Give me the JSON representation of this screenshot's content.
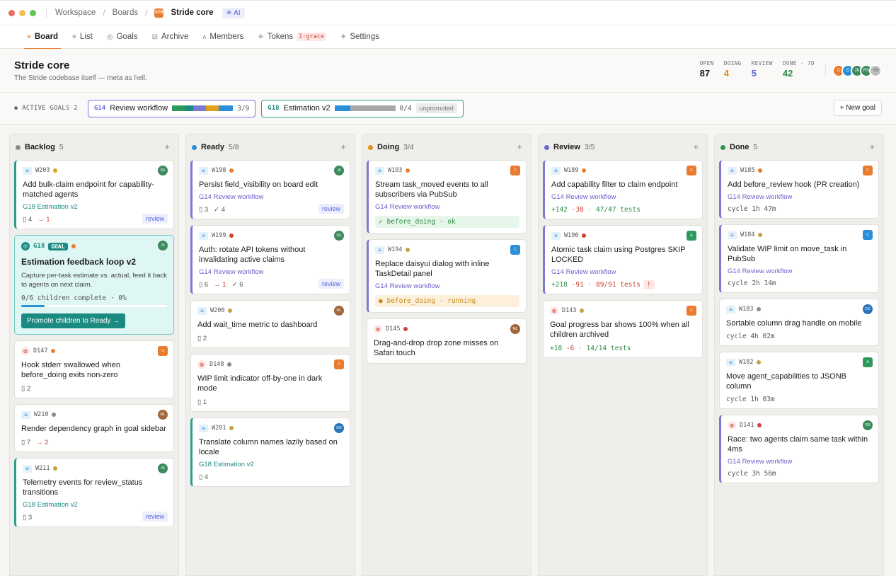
{
  "window": {
    "traffic": [
      "#ee6a5f",
      "#f5be4f",
      "#61c454"
    ]
  },
  "breadcrumb": {
    "workspace": "Workspace",
    "boards": "Boards",
    "badge": "STR",
    "project": "Stride core",
    "ai": "AI"
  },
  "tabs": [
    {
      "label": "Board",
      "icon": "≡",
      "active": true
    },
    {
      "label": "List",
      "icon": "≡"
    },
    {
      "label": "Goals",
      "icon": "◎"
    },
    {
      "label": "Archive",
      "icon": "⊟"
    },
    {
      "label": "Members",
      "icon": "ᴧ"
    },
    {
      "label": "Tokens",
      "icon": "✳",
      "badge": "1·grace"
    },
    {
      "label": "Settings",
      "icon": "✳"
    }
  ],
  "header": {
    "title": "Stride core",
    "desc": "The Stride codebase itself — meta as hell.",
    "stats": [
      {
        "label": "OPEN",
        "value": "87",
        "color": "#1c1c1c"
      },
      {
        "label": "DOING",
        "value": "4",
        "color": "#d98a1a"
      },
      {
        "label": "REVIEW",
        "value": "5",
        "color": "#5a66d8"
      },
      {
        "label": "DONE · 7D",
        "value": "42",
        "color": "#2d8a44"
      }
    ],
    "avatars": [
      {
        "t": "C",
        "c": "#e97b2e"
      },
      {
        "t": "C",
        "c": "#2a8fd6"
      },
      {
        "t": "JK",
        "c": "#3d8a5c"
      },
      {
        "t": "RS",
        "c": "#3d8a5c"
      },
      {
        "t": "+3",
        "c": "#bdbdbd"
      }
    ]
  },
  "goals": {
    "label": "ACTIVE GOALS",
    "count": "2",
    "chips": [
      {
        "id": "G14",
        "name": "Review workflow",
        "count": "3/9"
      },
      {
        "id": "G18",
        "name": "Estimation v2",
        "count": "0/4",
        "extra": "unpromoted"
      }
    ],
    "new_goal": "+ New goal"
  },
  "columns": [
    {
      "name": "Backlog",
      "count": "5",
      "color": "#8a8a8a",
      "cards": [
        {
          "id": "W203",
          "type": "task",
          "prio": "#e0a020",
          "av": "RS",
          "avc": "#3d8a5c",
          "title": "Add bulk-claim endpoint for capability-matched agents",
          "goal": "G18 Estimation v2",
          "goalTeal": true,
          "m1": "▯ 4",
          "m2": "→ 1",
          "pill": "review",
          "border": "c-blue"
        },
        {
          "goalcard": true,
          "id": "G18",
          "label": "GOAL",
          "av": "JK",
          "title": "Estimation feedback loop v2",
          "desc": "Capture per-task estimate vs. actual, feed it back to agents on next claim.",
          "progress": "0/6 children complete · 0%",
          "btn": "Promote children to Ready →"
        },
        {
          "id": "D147",
          "type": "bug",
          "prio": "#e97b2e",
          "av": "C",
          "avc": "#e97b2e",
          "sq": true,
          "title": "Hook stderr swallowed when before_doing exits non-zero",
          "m1": "▯ 2",
          "border": "c-none"
        },
        {
          "id": "W210",
          "type": "task",
          "prio": "#8a8a8a",
          "av": "ML",
          "avc": "#a0673c",
          "title": "Render dependency graph in goal sidebar",
          "m1": "▯ 7",
          "m2": "→ 2",
          "border": "c-none"
        },
        {
          "id": "W211",
          "type": "task",
          "prio": "#c8a040",
          "av": "JK",
          "avc": "#3d8a5c",
          "title": "Telemetry events for review_status transitions",
          "goal": "G18 Estimation v2",
          "goalTeal": true,
          "m1": "▯ 3",
          "pill": "review",
          "border": "c-blue"
        }
      ]
    },
    {
      "name": "Ready",
      "count": "5/8",
      "color": "#2a8fd6",
      "cards": [
        {
          "id": "W198",
          "type": "task",
          "prio": "#e97b2e",
          "av": "JK",
          "avc": "#3d8a5c",
          "title": "Persist field_visibility on board edit",
          "goal": "G14 Review workflow",
          "m1": "▯ 3",
          "m3": "✓ 4",
          "pill": "review",
          "border": "c-purple"
        },
        {
          "id": "W199",
          "type": "task",
          "prio": "#d04035",
          "av": "RS",
          "avc": "#3d8a5c",
          "title": "Auth: rotate API tokens without invalidating active claims",
          "goal": "G14 Review workflow",
          "m1": "▯ 6",
          "m2": "→ 1",
          "m3": "✓ 6",
          "pill": "review",
          "border": "c-purple"
        },
        {
          "id": "W200",
          "type": "task",
          "prio": "#c8a040",
          "av": "ML",
          "avc": "#a0673c",
          "title": "Add wait_time metric to dashboard",
          "m1": "▯ 2",
          "border": "c-none"
        },
        {
          "id": "D148",
          "type": "bug",
          "prio": "#8a8a8a",
          "av": "C",
          "avc": "#e97b2e",
          "sq": true,
          "title": "WIP limit indicator off-by-one in dark mode",
          "m1": "▯ 1",
          "border": "c-none"
        },
        {
          "id": "W201",
          "type": "task",
          "prio": "#c8a040",
          "av": "DO",
          "avc": "#2a73b8",
          "title": "Translate column names lazily based on locale",
          "goal": "G18 Estimation v2",
          "goalTeal": true,
          "m1": "▯ 4",
          "border": "c-blue"
        }
      ]
    },
    {
      "name": "Doing",
      "count": "3/4",
      "color": "#e0901a",
      "cards": [
        {
          "id": "W193",
          "type": "task",
          "prio": "#e97b2e",
          "av": "C",
          "avc": "#e97b2e",
          "sq": true,
          "title": "Stream task_moved events to all subscribers via PubSub",
          "goal": "G14 Review workflow",
          "hook": "✓ before_doing · ok",
          "hookType": "ok",
          "border": "c-purple"
        },
        {
          "id": "W194",
          "type": "task",
          "prio": "#c8a040",
          "av": "C",
          "avc": "#2a8fd6",
          "sq": true,
          "title": "Replace daisyui dialog with inline TaskDetail panel",
          "goal": "G14 Review workflow",
          "hook": "● before_doing · running",
          "hookType": "run",
          "border": "c-purple"
        },
        {
          "id": "D145",
          "type": "bug",
          "prio": "#d04035",
          "av": "ML",
          "avc": "#a0673c",
          "title": "Drag-and-drop drop zone misses on Safari touch",
          "border": "c-none"
        }
      ]
    },
    {
      "name": "Review",
      "count": "3/5",
      "color": "#6b68d8",
      "cards": [
        {
          "id": "W189",
          "type": "task",
          "prio": "#e97b2e",
          "av": "C",
          "avc": "#e97b2e",
          "sq": true,
          "title": "Add capability filter to claim endpoint",
          "goal": "G14 Review workflow",
          "diffAdd": "+142",
          "diffDel": "-38",
          "diffTests": "47/47 tests",
          "border": "c-purple"
        },
        {
          "id": "W190",
          "type": "task",
          "prio": "#d04035",
          "av": "A",
          "avc": "#2d9a5c",
          "sq": true,
          "title": "Atomic task claim using Postgres SKIP LOCKED",
          "goal": "G14 Review workflow",
          "diffAdd": "+218",
          "diffDel": "-91",
          "diffTests": "89/91 tests",
          "diffWarn": "!",
          "border": "c-purple"
        },
        {
          "id": "D143",
          "type": "bug",
          "prio": "#c8a040",
          "av": "C",
          "avc": "#e97b2e",
          "sq": true,
          "title": "Goal progress bar shows 100% when all children archived",
          "diffAdd": "+18",
          "diffDel": "-6",
          "diffTests": "14/14 tests",
          "border": "c-none"
        }
      ]
    },
    {
      "name": "Done",
      "count": "5",
      "color": "#2d9a4c",
      "cards": [
        {
          "id": "W185",
          "type": "task",
          "prio": "#e97b2e",
          "av": "C",
          "avc": "#e97b2e",
          "sq": true,
          "title": "Add before_review hook (PR creation)",
          "goal": "G14 Review workflow",
          "cycle": "cycle 1h 47m",
          "border": "c-purple"
        },
        {
          "id": "W184",
          "type": "task",
          "prio": "#c8a040",
          "av": "C",
          "avc": "#2a8fd6",
          "sq": true,
          "title": "Validate WIP limit on move_task in PubSub",
          "goal": "G14 Review workflow",
          "cycle": "cycle 2h 14m",
          "border": "c-purple"
        },
        {
          "id": "W183",
          "type": "task",
          "prio": "#8a8a8a",
          "av": "DO",
          "avc": "#2a73b8",
          "title": "Sortable column drag handle on mobile",
          "cycle": "cycle 4h 02m",
          "border": "c-none"
        },
        {
          "id": "W182",
          "type": "task",
          "prio": "#c8a040",
          "av": "A",
          "avc": "#2d9a5c",
          "sq": true,
          "title": "Move agent_capabilities to JSONB column",
          "cycle": "cycle 1h 03m",
          "border": "c-none"
        },
        {
          "id": "D141",
          "type": "bug",
          "prio": "#d04035",
          "av": "RS",
          "avc": "#3d8a5c",
          "title": "Race: two agents claim same task within 4ms",
          "goal": "G14 Review workflow",
          "cycle": "cycle 3h 56m",
          "border": "c-purple"
        }
      ]
    }
  ]
}
